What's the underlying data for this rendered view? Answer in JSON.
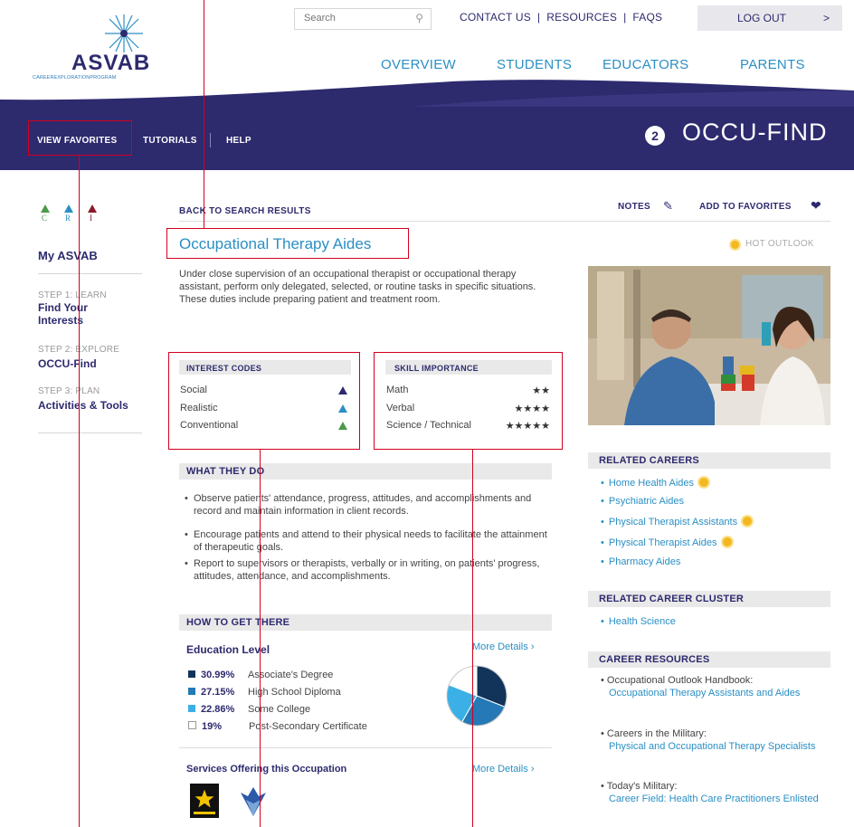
{
  "header": {
    "search_placeholder": "Search",
    "top_links": [
      "CONTACT US",
      "RESOURCES",
      "FAQS"
    ],
    "logout_label": "LOG OUT",
    "logout_arrow": ">",
    "main_nav": [
      "OVERVIEW",
      "STUDENTS",
      "EDUCATORS",
      "PARENTS"
    ],
    "logo_text": "ASVAB",
    "logo_subtext": "CAREEREXPLORATIONPROGRAM"
  },
  "subnav": {
    "items": [
      "VIEW FAVORITES",
      "TUTORIALS",
      "HELP"
    ],
    "step_number": "2",
    "section_title": "OCCU-FIND"
  },
  "sidebar": {
    "cri_letters": [
      "C",
      "R",
      "I"
    ],
    "title": "My ASVAB",
    "steps": [
      {
        "label": "STEP 1: LEARN",
        "link": "Find Your Interests"
      },
      {
        "label": "STEP 2: EXPLORE",
        "link": "OCCU-Find"
      },
      {
        "label": "STEP 3: PLAN",
        "link": "Activities & Tools"
      }
    ]
  },
  "main": {
    "back_link": "BACK TO SEARCH RESULTS",
    "notes_label": "NOTES",
    "favorites_label": "ADD TO FAVORITES",
    "title": "Occupational Therapy Aides",
    "hot_outlook": "HOT OUTLOOK",
    "description": "Under close supervision of an occupational therapist or occupational therapy assistant, perform only delegated, selected, or routine tasks in specific situations. These duties include preparing patient and treatment room.",
    "interest_codes": {
      "heading": "INTEREST CODES",
      "items": [
        {
          "label": "Social",
          "color": "#2d2a6e"
        },
        {
          "label": "Realistic",
          "color": "#2a8fc4"
        },
        {
          "label": "Conventional",
          "color": "#4a9a4a"
        }
      ]
    },
    "skill_importance": {
      "heading": "SKILL IMPORTANCE",
      "items": [
        {
          "label": "Math",
          "stars": 2,
          "stars_text": "★★"
        },
        {
          "label": "Verbal",
          "stars": 4,
          "stars_text": "★★★★"
        },
        {
          "label": "Science / Technical",
          "stars": 5,
          "stars_text": "★★★★★"
        }
      ]
    },
    "what_they_do": {
      "heading": "WHAT THEY DO",
      "bullets": [
        "Observe patients' attendance, progress, attitudes, and accomplishments and record and maintain information in client records.",
        "Encourage patients and attend to their physical needs to facilitate the attainment of therapeutic goals.",
        "Report to supervisors or therapists, verbally or in writing, on patients' progress, attitudes, attendance, and accomplishments."
      ]
    },
    "how_to_get_there": {
      "heading": "HOW TO GET THERE",
      "education_label": "Education Level",
      "more_details": "More Details",
      "education": [
        {
          "pct": "30.99%",
          "label": "Associate's Degree",
          "color": "#12345a"
        },
        {
          "pct": "27.15%",
          "label": "High School Diploma",
          "color": "#2479b6"
        },
        {
          "pct": "22.86%",
          "label": "Some College",
          "color": "#3ab0e6"
        },
        {
          "pct": "19%",
          "label": "Post-Secondary Certificate",
          "color": "#ffffff"
        }
      ],
      "services_label": "Services Offering this Occupation",
      "services_more": "More Details"
    }
  },
  "right": {
    "related_careers_heading": "RELATED CAREERS",
    "related_careers": [
      {
        "label": "Home Health Aides",
        "hot": true
      },
      {
        "label": "Psychiatric Aides",
        "hot": false
      },
      {
        "label": "Physical Therapist Assistants",
        "hot": true
      },
      {
        "label": "Physical Therapist Aides",
        "hot": true
      },
      {
        "label": "Pharmacy Aides",
        "hot": false
      }
    ],
    "cluster_heading": "RELATED CAREER CLUSTER",
    "cluster_item": "Health Science",
    "resources_heading": "CAREER RESOURCES",
    "resources": [
      {
        "title": "Occupational Outlook Handbook:",
        "link": "Occupational Therapy Assistants and Aides"
      },
      {
        "title": "Careers in the Military:",
        "link": "Physical and Occupational Therapy Specialists"
      },
      {
        "title": "Today's Military:",
        "link": "Career Field: Health Care Practitioners Enlisted"
      }
    ]
  }
}
